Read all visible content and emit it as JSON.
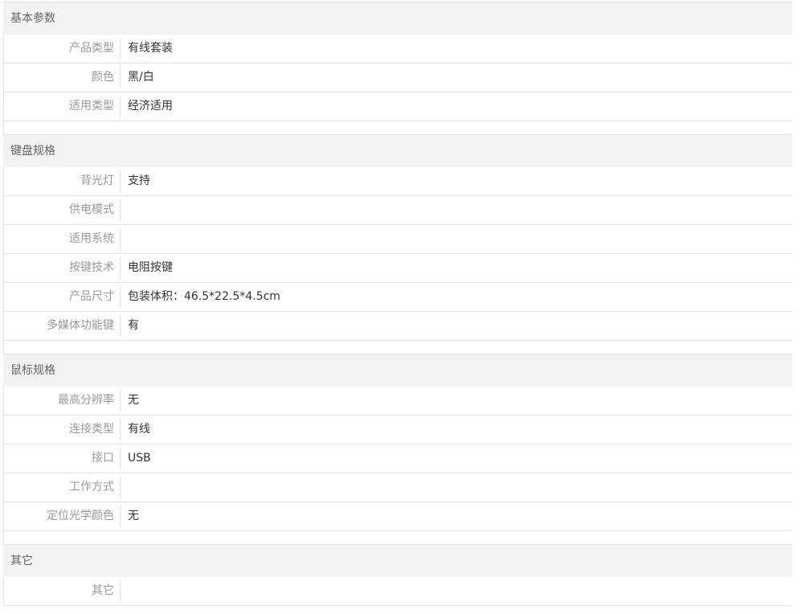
{
  "sections": [
    {
      "title": "基本参数",
      "rows": [
        {
          "label": "产品类型",
          "value": "有线套装"
        },
        {
          "label": "颜色",
          "value": "黑/白"
        },
        {
          "label": "适用类型",
          "value": "经济适用"
        }
      ]
    },
    {
      "title": "键盘规格",
      "rows": [
        {
          "label": "背光灯",
          "value": "支持"
        },
        {
          "label": "供电模式",
          "value": ""
        },
        {
          "label": "适用系统",
          "value": ""
        },
        {
          "label": "按键技术",
          "value": "电阻按键"
        },
        {
          "label": "产品尺寸",
          "value": "包装体积：46.5*22.5*4.5cm"
        },
        {
          "label": "多媒体功能键",
          "value": "有"
        }
      ]
    },
    {
      "title": "鼠标规格",
      "rows": [
        {
          "label": "最高分辨率",
          "value": "无"
        },
        {
          "label": "连接类型",
          "value": "有线"
        },
        {
          "label": "接口",
          "value": "USB"
        },
        {
          "label": "工作方式",
          "value": ""
        },
        {
          "label": "定位光学颜色",
          "value": "无"
        }
      ]
    },
    {
      "title": "其它",
      "rows": [
        {
          "label": "其它",
          "value": ""
        }
      ]
    }
  ]
}
